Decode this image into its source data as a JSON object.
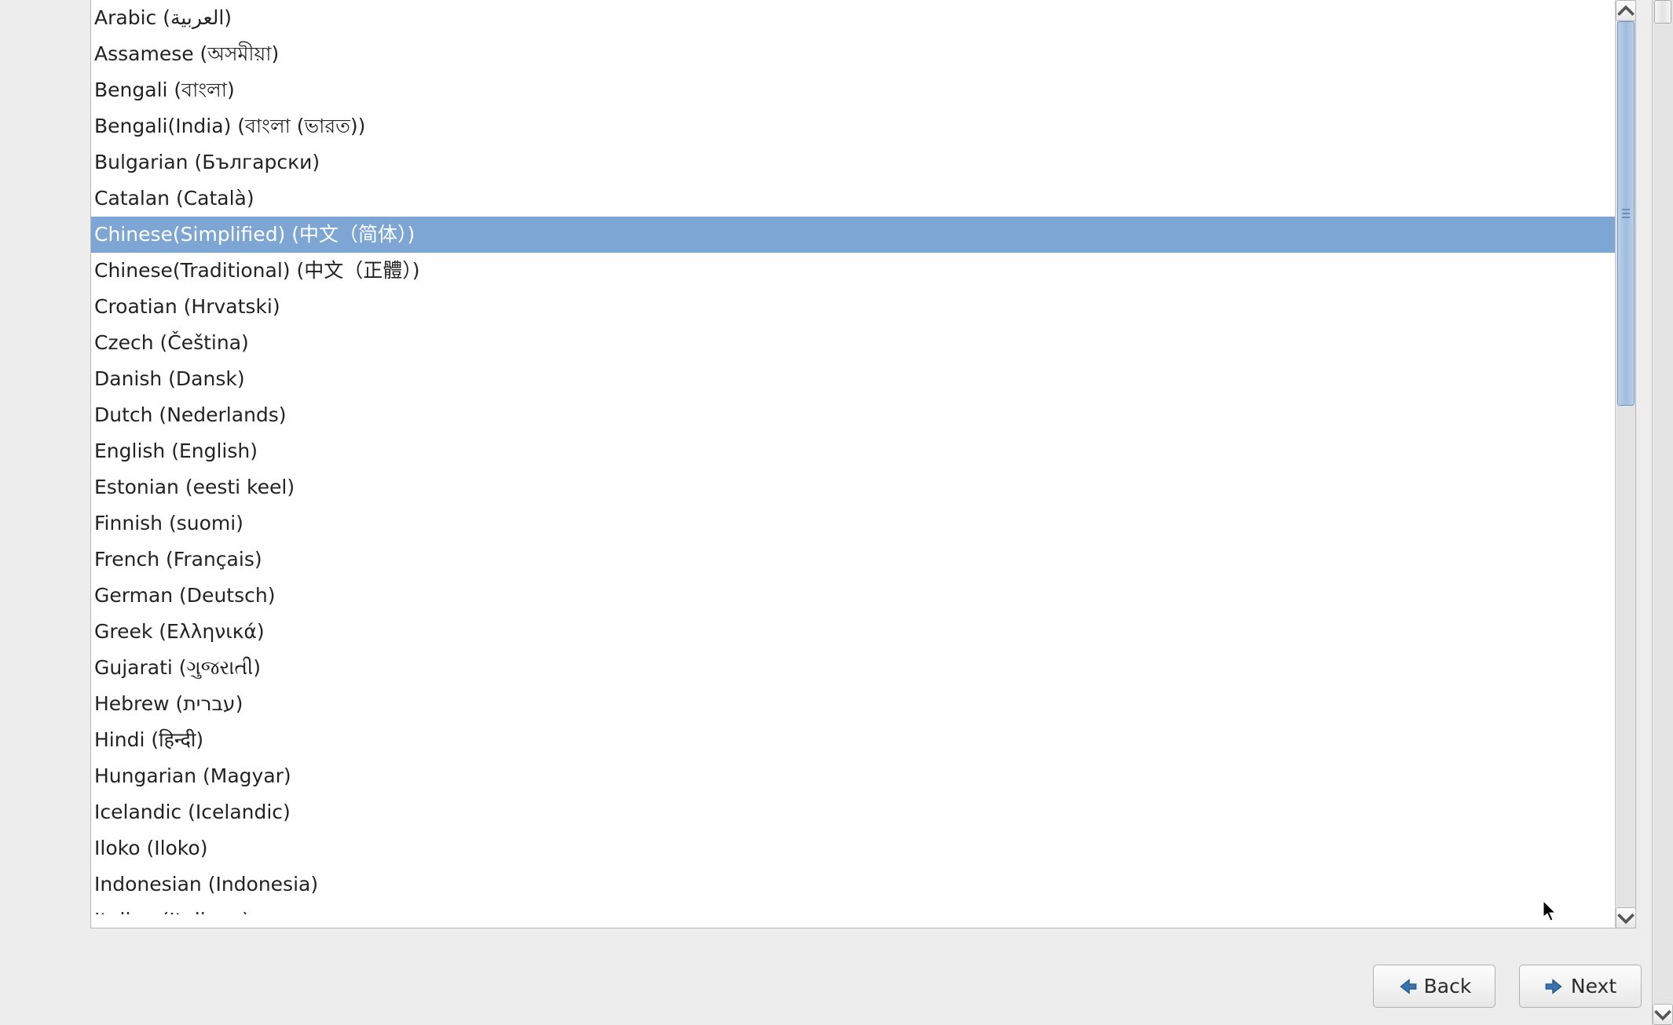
{
  "languages": {
    "items": [
      {
        "label": "Arabic (العربية)",
        "selected": false
      },
      {
        "label": "Assamese (অসমীয়া)",
        "selected": false
      },
      {
        "label": "Bengali (বাংলা)",
        "selected": false
      },
      {
        "label": "Bengali(India) (বাংলা (ভারত))",
        "selected": false
      },
      {
        "label": "Bulgarian (Български)",
        "selected": false
      },
      {
        "label": "Catalan (Català)",
        "selected": false
      },
      {
        "label": "Chinese(Simplified) (中文（简体）)",
        "selected": true
      },
      {
        "label": "Chinese(Traditional) (中文（正體）)",
        "selected": false
      },
      {
        "label": "Croatian (Hrvatski)",
        "selected": false
      },
      {
        "label": "Czech (Čeština)",
        "selected": false
      },
      {
        "label": "Danish (Dansk)",
        "selected": false
      },
      {
        "label": "Dutch (Nederlands)",
        "selected": false
      },
      {
        "label": "English (English)",
        "selected": false
      },
      {
        "label": "Estonian (eesti keel)",
        "selected": false
      },
      {
        "label": "Finnish (suomi)",
        "selected": false
      },
      {
        "label": "French (Français)",
        "selected": false
      },
      {
        "label": "German (Deutsch)",
        "selected": false
      },
      {
        "label": "Greek (Ελληνικά)",
        "selected": false
      },
      {
        "label": "Gujarati (ગુજરાતી)",
        "selected": false
      },
      {
        "label": "Hebrew (עברית)",
        "selected": false
      },
      {
        "label": "Hindi (हिन्दी)",
        "selected": false
      },
      {
        "label": "Hungarian (Magyar)",
        "selected": false
      },
      {
        "label": "Icelandic (Icelandic)",
        "selected": false
      },
      {
        "label": "Iloko (Iloko)",
        "selected": false
      },
      {
        "label": "Indonesian (Indonesia)",
        "selected": false
      },
      {
        "label": "Italian (Italiano)",
        "selected": false
      }
    ]
  },
  "buttons": {
    "back_label": "Back",
    "next_label": "Next"
  }
}
